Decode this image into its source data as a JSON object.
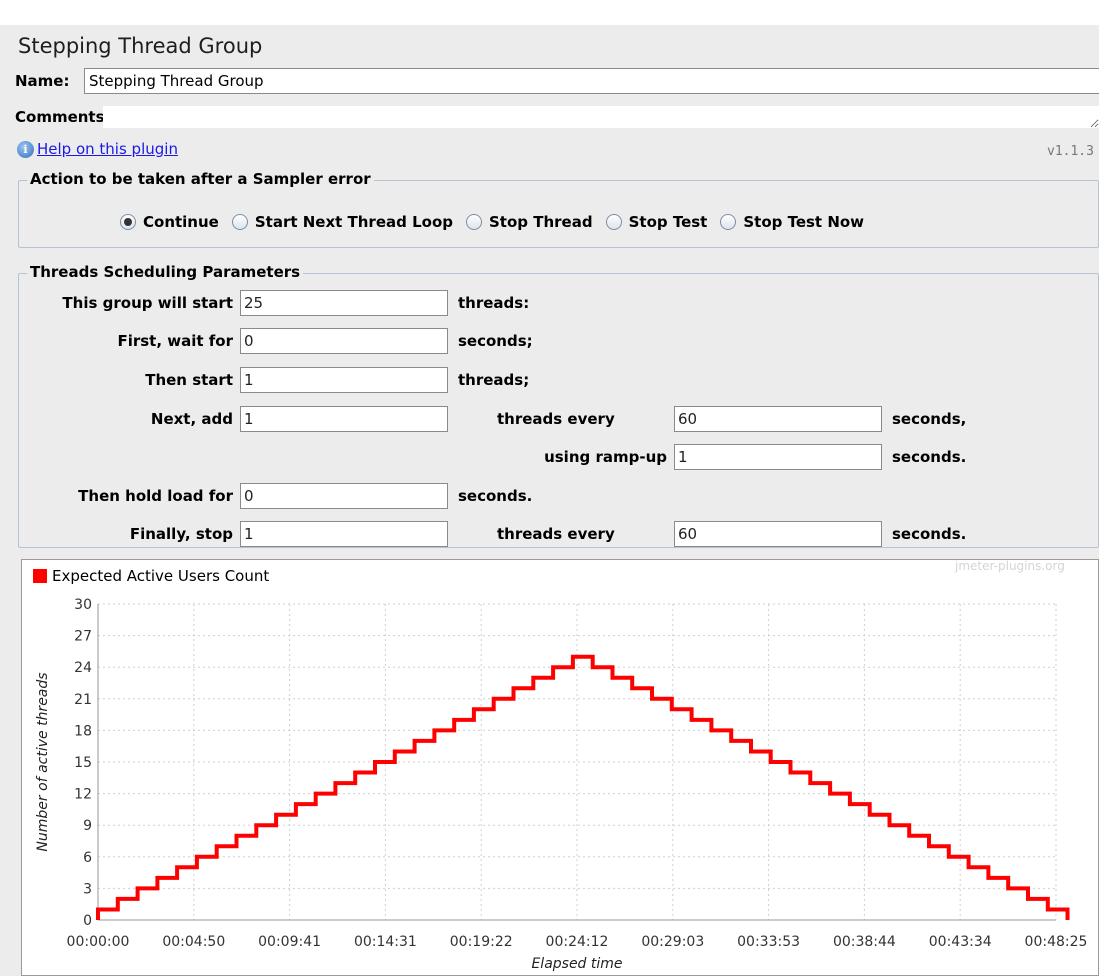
{
  "panel": {
    "title": "Stepping Thread Group",
    "name_label": "Name:",
    "name_value": "Stepping Thread Group",
    "comments_label": "Comments:",
    "help_link": "Help on this plugin",
    "version": "v1.1.3"
  },
  "sampler_error": {
    "title": "Action to be taken after a Sampler error",
    "options": [
      {
        "label": "Continue",
        "checked": true
      },
      {
        "label": "Start Next Thread Loop",
        "checked": false
      },
      {
        "label": "Stop Thread",
        "checked": false
      },
      {
        "label": "Stop Test",
        "checked": false
      },
      {
        "label": "Stop Test Now",
        "checked": false
      }
    ]
  },
  "scheduling": {
    "title": "Threads Scheduling Parameters",
    "start_label": "This group will start",
    "start_value": "25",
    "start_unit": "threads:",
    "wait_label": "First, wait for",
    "wait_value": "0",
    "wait_unit": "seconds;",
    "then_start_label": "Then start",
    "then_start_value": "1",
    "then_start_unit": "threads;",
    "next_add_label": "Next, add",
    "next_add_value": "1",
    "next_add_mid": "threads every",
    "next_add_every_value": "60",
    "next_add_unit": "seconds,",
    "rampup_label": "using ramp-up",
    "rampup_value": "1",
    "rampup_unit": "seconds.",
    "hold_label": "Then hold load for",
    "hold_value": "0",
    "hold_unit": "seconds.",
    "stop_label": "Finally, stop",
    "stop_value": "1",
    "stop_mid": "threads every",
    "stop_every_value": "60",
    "stop_unit": "seconds."
  },
  "watermark": "jmeter-plugins.org",
  "chart_data": {
    "type": "line",
    "step": true,
    "xlabel": "Elapsed time",
    "ylabel": "Number of active threads",
    "x_ticks": [
      "00:00:00",
      "00:04:50",
      "00:09:41",
      "00:14:31",
      "00:19:22",
      "00:24:12",
      "00:29:03",
      "00:33:53",
      "00:38:44",
      "00:43:34",
      "00:48:25"
    ],
    "y_ticks": [
      0,
      3,
      6,
      9,
      12,
      15,
      18,
      21,
      24,
      27,
      30
    ],
    "ylim": [
      0,
      30
    ],
    "x_range_seconds": [
      0,
      2905
    ],
    "grid": true,
    "legend_position": "top-left",
    "color": "#ff0000",
    "series": [
      {
        "name": "Expected Active Users Count",
        "description_step_seconds": 60,
        "ramp_up": {
          "start_users": 1,
          "add_users": 1,
          "every_seconds": 60,
          "target": 25
        },
        "ramp_down": {
          "stop_users": 1,
          "every_seconds": 60
        }
      }
    ]
  }
}
